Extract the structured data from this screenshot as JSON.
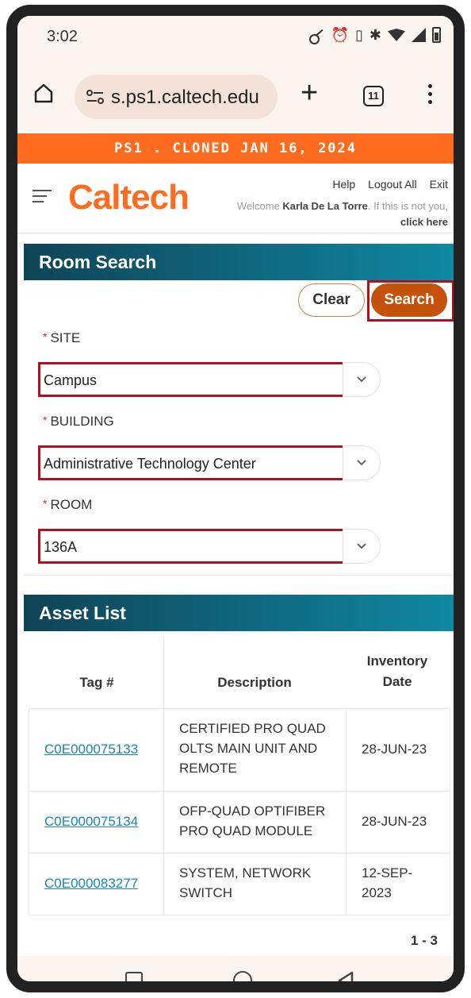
{
  "status_bar": {
    "time": "3:02",
    "icons": [
      "key-icon",
      "alarm-icon",
      "vibrate-icon",
      "bluetooth-icon",
      "wifi-icon",
      "signal-icon",
      "battery-icon"
    ]
  },
  "browser": {
    "url": "s.ps1.caltech.edu",
    "tab_count": "11"
  },
  "banner": {
    "text": "PS1 . CLONED JAN 16, 2024",
    "color": "#ff6c1f"
  },
  "header": {
    "logo": "Caltech",
    "links": [
      "Help",
      "Logout All",
      "Exit"
    ],
    "welcome_prefix": "Welcome ",
    "user_name": "Karla De La Torre",
    "welcome_mid": ". If this is not you, ",
    "click_here": "click here"
  },
  "room_search": {
    "title": "Room Search",
    "clear_label": "Clear",
    "search_label": "Search",
    "site_label": "SITE",
    "site_value": "Campus",
    "building_label": "BUILDING",
    "building_value": "Administrative Technology Center",
    "room_label": "ROOM",
    "room_value": "136A",
    "required_mark": "*"
  },
  "asset_list": {
    "title": "Asset List",
    "columns": [
      "Tag #",
      "Description",
      "Inventory Date"
    ],
    "rows": [
      {
        "tag": "C0E000075133",
        "description": "CERTIFIED PRO QUAD OLTS MAIN UNIT AND REMOTE",
        "date": "28-JUN-23"
      },
      {
        "tag": "C0E000075134",
        "description": "OFP-QUAD OPTIFIBER PRO QUAD MODULE",
        "date": "28-JUN-23"
      },
      {
        "tag": "C0E000083277",
        "description": "SYSTEM, NETWORK SWITCH",
        "date": "12-SEP-2023"
      }
    ],
    "pagination": "1 - 3"
  },
  "colors": {
    "accent": "#ff6c1f",
    "search_button": "#c4520b",
    "panel_header": "#0f6d85",
    "highlight": "#b01020",
    "link": "#1a86b8"
  }
}
